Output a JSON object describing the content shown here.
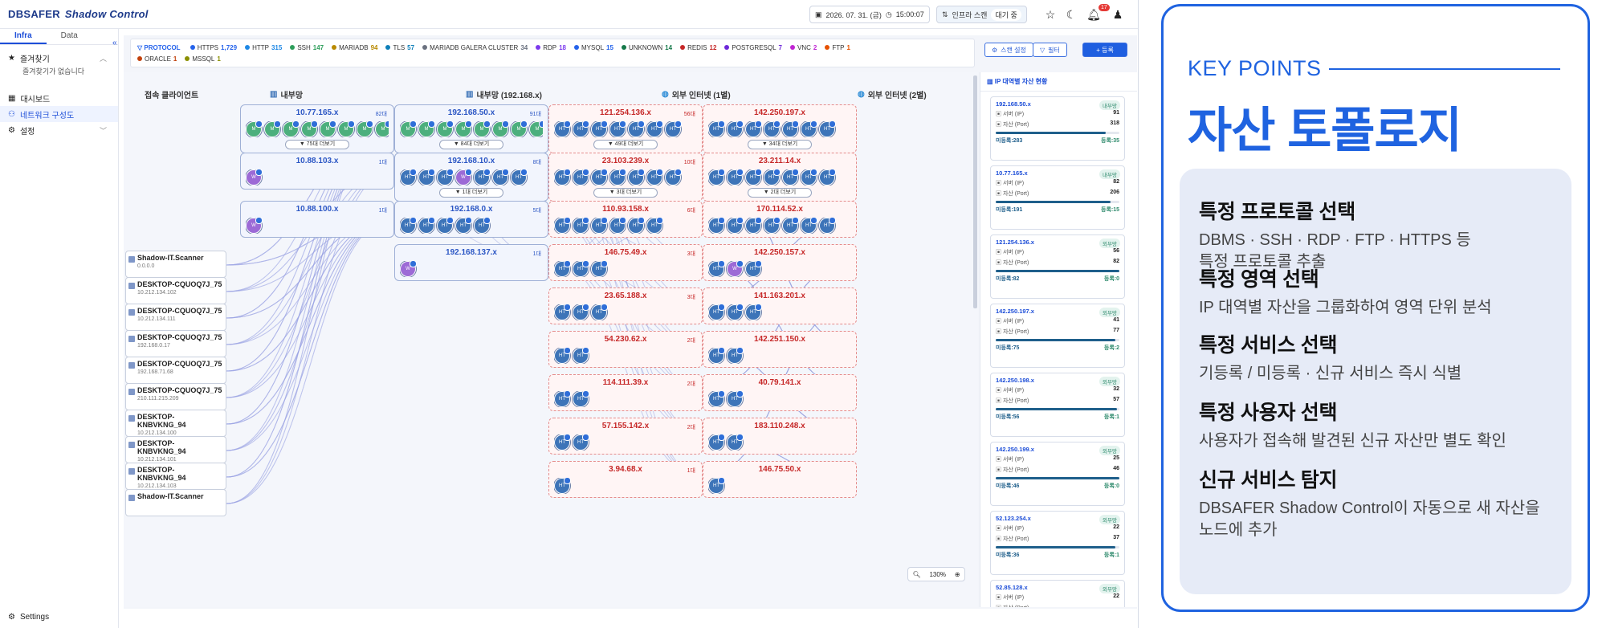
{
  "app": {
    "logo": "DBSAFER",
    "product": "Shadow Control"
  },
  "topbar": {
    "date": "2026. 07. 31. (금)",
    "time": "15:00:07",
    "infra_scan": "인프라 스캔",
    "status": "대기 중",
    "notif_count": "17"
  },
  "sidebar": {
    "tabs": [
      "Infra",
      "Data"
    ],
    "favorites": "즐겨찾기",
    "favorites_empty": "즐겨찾기가 없습니다",
    "dashboard": "대시보드",
    "network": "네트워크 구성도",
    "settings_menu": "설정",
    "settings_bottom": "Settings"
  },
  "protocol": {
    "label": "PROTOCOL",
    "items": [
      {
        "name": "HTTPS",
        "count": "1,729",
        "color": "#2563eb"
      },
      {
        "name": "HTTP",
        "count": "315",
        "color": "#1e88e5"
      },
      {
        "name": "SSH",
        "count": "147",
        "color": "#2e9e5b"
      },
      {
        "name": "MARIADB",
        "count": "94",
        "color": "#b98a00"
      },
      {
        "name": "TLS",
        "count": "57",
        "color": "#0e7fb8"
      },
      {
        "name": "MARIADB GALERA CLUSTER",
        "count": "34",
        "color": "#6b7280"
      },
      {
        "name": "RDP",
        "count": "18",
        "color": "#7c3aed"
      },
      {
        "name": "MYSQL",
        "count": "15",
        "color": "#2563eb"
      },
      {
        "name": "UNKNOWN",
        "count": "14",
        "color": "#16794a"
      },
      {
        "name": "REDIS",
        "count": "12",
        "color": "#c62828"
      },
      {
        "name": "POSTGRESQL",
        "count": "7",
        "color": "#6d28d9"
      },
      {
        "name": "VNC",
        "count": "2",
        "color": "#c026d3"
      },
      {
        "name": "FTP",
        "count": "1",
        "color": "#e65100"
      },
      {
        "name": "ORACLE",
        "count": "1",
        "color": "#c2410c"
      },
      {
        "name": "MSSQL",
        "count": "1",
        "color": "#8a8f00"
      }
    ]
  },
  "tools": {
    "scan": "스캔 설정",
    "filter": "필터",
    "add": "+ 등록"
  },
  "columns": {
    "clients": "접속 클라이언트",
    "internal": "내부망",
    "internal2": "내부망 (192.168.x)",
    "ext1": "외부 인터넷 (1별)",
    "ext2": "외부 인터넷 (2별)"
  },
  "internal_nodes": [
    {
      "ip": "10.77.165.x",
      "count": "82대",
      "icons": "gggggggg",
      "more": "▼ 75대 더보기"
    },
    {
      "ip": "10.88.103.x",
      "count": "1대",
      "icons": "p",
      "more": ""
    },
    {
      "ip": "10.88.100.x",
      "count": "1대",
      "icons": "p",
      "more": ""
    }
  ],
  "internal2_nodes": [
    {
      "ip": "192.168.50.x",
      "count": "91대",
      "icons": "gggggggg",
      "more": "▼ 84대 더보기"
    },
    {
      "ip": "192.168.10.x",
      "count": "8대",
      "icons": "bbbpbbb",
      "more": "▼ 1대 더보기"
    },
    {
      "ip": "192.168.0.x",
      "count": "5대",
      "icons": "bbbbb",
      "more": ""
    },
    {
      "ip": "192.168.137.x",
      "count": "1대",
      "icons": "p",
      "more": ""
    }
  ],
  "ext1_nodes": [
    {
      "ip": "121.254.136.x",
      "count": "56대",
      "icons": "bbbbbbb",
      "more": "▼ 49대 더보기"
    },
    {
      "ip": "23.103.239.x",
      "count": "10대",
      "icons": "bbbbbbb",
      "more": "▼ 3대 더보기"
    },
    {
      "ip": "110.93.158.x",
      "count": "6대",
      "icons": "bbbbbb",
      "more": ""
    },
    {
      "ip": "146.75.49.x",
      "count": "3대",
      "icons": "bbb",
      "more": ""
    },
    {
      "ip": "23.65.188.x",
      "count": "3대",
      "icons": "bbb",
      "more": ""
    },
    {
      "ip": "54.230.62.x",
      "count": "2대",
      "icons": "bb",
      "more": ""
    },
    {
      "ip": "114.111.39.x",
      "count": "2대",
      "icons": "bb",
      "more": ""
    },
    {
      "ip": "57.155.142.x",
      "count": "2대",
      "icons": "bb",
      "more": ""
    },
    {
      "ip": "3.94.68.x",
      "count": "1대",
      "icons": "b",
      "more": ""
    }
  ],
  "ext2_nodes": [
    {
      "ip": "142.250.197.x",
      "count": "",
      "icons": "bbbbbbb",
      "more": "▼ 34대 더보기"
    },
    {
      "ip": "23.211.14.x",
      "count": "",
      "icons": "bbbbbbb",
      "more": "▼ 2대 더보기"
    },
    {
      "ip": "170.114.52.x",
      "count": "",
      "icons": "bbbbbbb",
      "more": ""
    },
    {
      "ip": "142.250.157.x",
      "count": "",
      "icons": "bpb",
      "more": ""
    },
    {
      "ip": "141.163.201.x",
      "count": "",
      "icons": "bbb",
      "more": ""
    },
    {
      "ip": "142.251.150.x",
      "count": "",
      "icons": "bb",
      "more": ""
    },
    {
      "ip": "40.79.141.x",
      "count": "",
      "icons": "bb",
      "more": ""
    },
    {
      "ip": "183.110.248.x",
      "count": "",
      "icons": "bb",
      "more": ""
    },
    {
      "ip": "146.75.50.x",
      "count": "",
      "icons": "b",
      "more": ""
    }
  ],
  "clients": [
    {
      "name": "Shadow-IT.Scanner",
      "addr": "0.0.0.0"
    },
    {
      "name": "DESKTOP-CQUOQ7J_75",
      "addr": "10.212.134.102"
    },
    {
      "name": "DESKTOP-CQUOQ7J_75",
      "addr": "10.212.134.111"
    },
    {
      "name": "DESKTOP-CQUOQ7J_75",
      "addr": "192.168.0.17"
    },
    {
      "name": "DESKTOP-CQUOQ7J_75",
      "addr": "192.168.71.68"
    },
    {
      "name": "DESKTOP-CQUOQ7J_75",
      "addr": "210.111.215.209"
    },
    {
      "name": "DESKTOP-KNBVKNG_94",
      "addr": "10.212.134.100"
    },
    {
      "name": "DESKTOP-KNBVKNG_94",
      "addr": "10.212.134.101"
    },
    {
      "name": "DESKTOP-KNBVKNG_94",
      "addr": "10.212.134.103"
    },
    {
      "name": "Shadow-IT.Scanner",
      "addr": ""
    }
  ],
  "zoom": "130%",
  "right_panel": {
    "title": "IP 대역별 자산 현황",
    "server_label": "서버 (IP)",
    "asset_label": "자산 (Port)",
    "cards": [
      {
        "ip": "192.168.50.x",
        "tag": "내부망",
        "servers": "91",
        "assets": "318",
        "unreg": "미등록:283",
        "reg": "등록:35",
        "fill": 0.89
      },
      {
        "ip": "10.77.165.x",
        "tag": "내부망",
        "servers": "82",
        "assets": "206",
        "unreg": "미등록:191",
        "reg": "등록:15",
        "fill": 0.93
      },
      {
        "ip": "121.254.136.x",
        "tag": "외부망",
        "servers": "56",
        "assets": "82",
        "unreg": "미등록:82",
        "reg": "등록:0",
        "fill": 1
      },
      {
        "ip": "142.250.197.x",
        "tag": "외부망",
        "servers": "41",
        "assets": "77",
        "unreg": "미등록:75",
        "reg": "등록:2",
        "fill": 0.97
      },
      {
        "ip": "142.250.198.x",
        "tag": "외부망",
        "servers": "32",
        "assets": "57",
        "unreg": "미등록:56",
        "reg": "등록:1",
        "fill": 0.98
      },
      {
        "ip": "142.250.199.x",
        "tag": "외부망",
        "servers": "25",
        "assets": "46",
        "unreg": "미등록:46",
        "reg": "등록:0",
        "fill": 1
      },
      {
        "ip": "52.123.254.x",
        "tag": "외부망",
        "servers": "22",
        "assets": "37",
        "unreg": "미등록:36",
        "reg": "등록:1",
        "fill": 0.97
      },
      {
        "ip": "52.85.128.x",
        "tag": "외부망",
        "servers": "22",
        "assets": "",
        "unreg": "",
        "reg": "",
        "fill": 1
      }
    ]
  },
  "keypoints": {
    "label": "KEY POINTS",
    "title": "자산 토폴로지",
    "items": [
      {
        "h": "특정 프로토콜 선택",
        "p": "DBMS · SSH · RDP · FTP · HTTPS 등\n특정 프로토콜 추출"
      },
      {
        "h": "특정 영역 선택",
        "p": "IP 대역별 자산을 그룹화하여 영역 단위 분석"
      },
      {
        "h": "특정 서비스 선택",
        "p": "기등록 / 미등록 · 신규 서비스 즉시 식별"
      },
      {
        "h": "특정 사용자 선택",
        "p": "사용자가 접속해 발견된 신규 자산만 별도 확인"
      },
      {
        "h": "신규 서비스 탐지",
        "p": "DBSAFER Shadow Control이 자동으로 새 자산을\n노드에 추가"
      }
    ]
  }
}
